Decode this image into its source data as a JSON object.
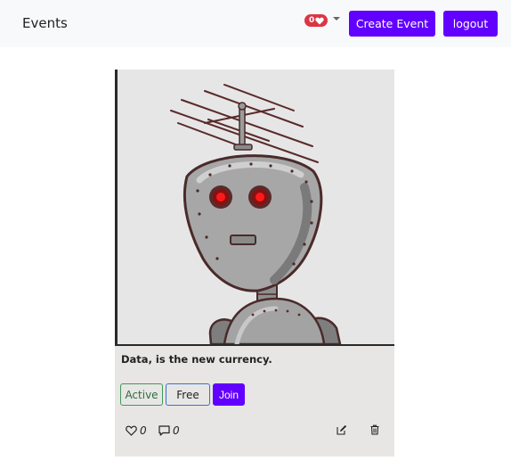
{
  "navbar": {
    "brand": "Events",
    "notification_count": "0",
    "create_label": "Create Event",
    "logout_label": "logout"
  },
  "event": {
    "title": "Data, is the new currency.",
    "status": "Active",
    "price": "Free",
    "join_label": "Join",
    "likes": "0",
    "comments": "0"
  },
  "colors": {
    "accent": "#6200ff",
    "notification": "#dc3545",
    "active_border": "#3c9b5a",
    "free_border": "#3d6fd6"
  },
  "icons": [
    "heart-icon",
    "caret-down-icon",
    "heart-outline-icon",
    "comment-icon",
    "edit-icon",
    "trash-icon"
  ]
}
